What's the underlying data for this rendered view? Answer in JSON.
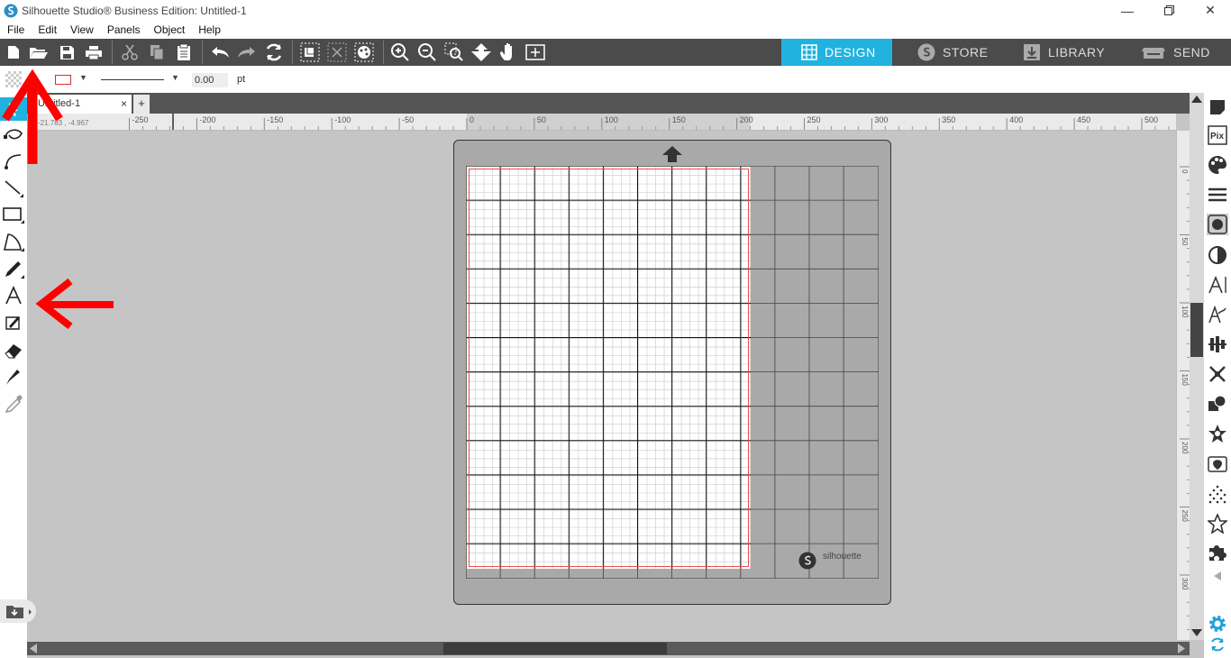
{
  "window": {
    "title": "Silhouette Studio® Business Edition: Untitled-1",
    "minimize": "—",
    "maximize": "❐",
    "close": "✕"
  },
  "menu": [
    "File",
    "Edit",
    "View",
    "Panels",
    "Object",
    "Help"
  ],
  "mode_tabs": [
    {
      "label": "DESIGN",
      "active": true,
      "icon": "grid-icon"
    },
    {
      "label": "STORE",
      "active": false,
      "icon": "silhouette-s-icon"
    },
    {
      "label": "LIBRARY",
      "active": false,
      "icon": "download-box-icon"
    },
    {
      "label": "SEND",
      "active": false,
      "icon": "cutter-icon"
    }
  ],
  "properties": {
    "stroke_width": "0.00",
    "unit": "pt"
  },
  "document_tab": {
    "name": "Untitled-1",
    "close": "×",
    "add": "+"
  },
  "cursor_coords": "-21.783 , -4.967",
  "ruler": {
    "horizontal_ticks": [
      "-250",
      "-200",
      "-150",
      "-100",
      "-50",
      "0",
      "50",
      "100",
      "150",
      "200",
      "250",
      "300",
      "350",
      "400",
      "450",
      "500"
    ],
    "vertical_ticks": [
      "0",
      "50",
      "100",
      "150",
      "200",
      "250",
      "300"
    ]
  },
  "mat": {
    "brand": "silhouette"
  },
  "colors": {
    "toolbar_bg": "#4b4b4b",
    "design_accent": "#21b2df",
    "annotation_arrow": "#ff0000",
    "canvas_bg": "#c5c5c5",
    "mat_bg": "#a9a9a9",
    "cut_border": "#e74c4c",
    "settings_icon": "#21a0d8"
  }
}
